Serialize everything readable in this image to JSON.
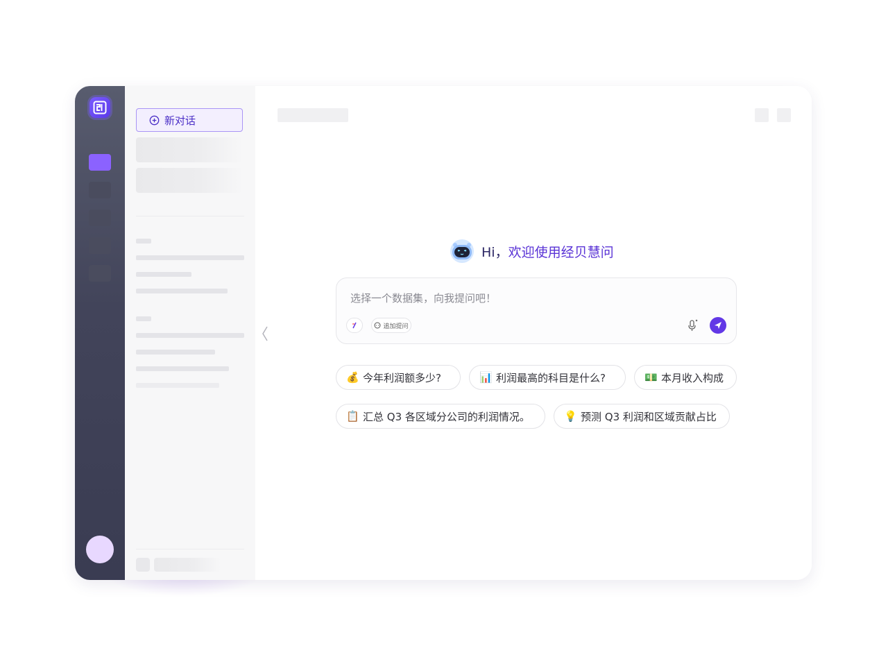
{
  "sidebar": {
    "new_chat_label": "新对话"
  },
  "main": {
    "greeting_prefix": "Hi，",
    "greeting_brand": "欢迎使用经贝慧问",
    "input_placeholder": "选择一个数据集，向我提问吧！",
    "append_question_label": "追加提问",
    "suggestions": [
      {
        "icon": "money-bag-icon",
        "glyph": "💰",
        "text": "今年利润额多少?"
      },
      {
        "icon": "bar-chart-icon",
        "glyph": "📊",
        "text": "利润最高的科目是什么?"
      },
      {
        "icon": "banknote-icon",
        "glyph": "💵",
        "text": "本月收入构成"
      },
      {
        "icon": "clipboard-icon",
        "glyph": "📋",
        "text": "汇总 Q3 各区域分公司的利润情况。"
      },
      {
        "icon": "lightbulb-icon",
        "glyph": "💡",
        "text": "预测 Q3 利润和区域贡献占比"
      }
    ]
  },
  "colors": {
    "accent": "#6238e6",
    "rail_active": "#8b62ff",
    "brand_text": "#5a33d6"
  }
}
